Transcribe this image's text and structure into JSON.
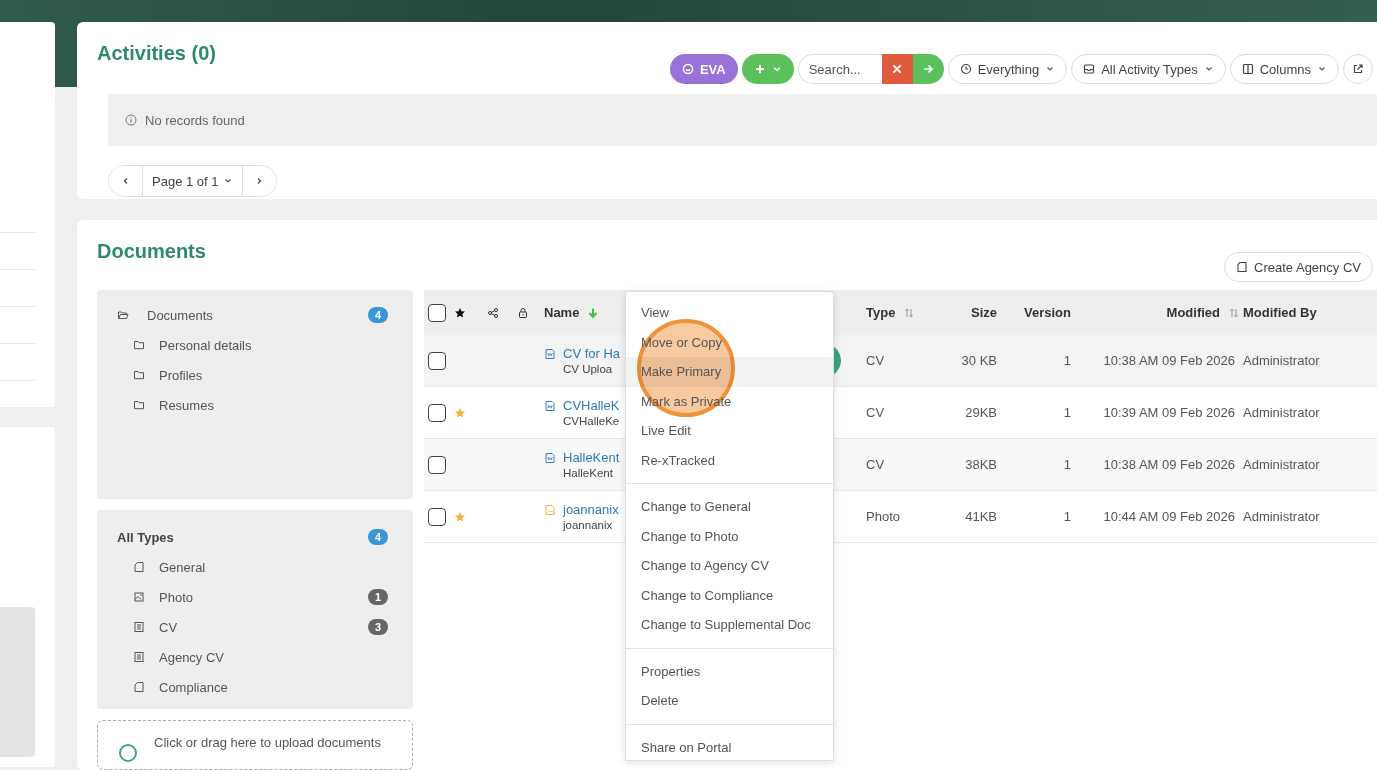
{
  "activities": {
    "title": "Activities (0)",
    "toolbar": {
      "eva_label": "EVA",
      "search": {
        "placeholder": "Search..."
      },
      "filters": [
        {
          "kind": "clock",
          "label": "Everything"
        },
        {
          "kind": "inbox",
          "label": "All Activity Types"
        },
        {
          "kind": "columns",
          "label": "Columns"
        }
      ]
    },
    "empty_message": "No records found",
    "pagination": {
      "page_label": "Page 1 of 1"
    }
  },
  "documents": {
    "title": "Documents",
    "create_button": "Create Agency CV",
    "folders": [
      {
        "label": "Documents",
        "count": "4",
        "children": [
          {
            "label": "Personal details"
          },
          {
            "label": "Profiles"
          },
          {
            "label": "Resumes"
          }
        ]
      }
    ],
    "types": {
      "label": "All Types",
      "count": "4",
      "items": [
        {
          "kind": "page",
          "label": "General"
        },
        {
          "kind": "image",
          "label": "Photo",
          "count": "1"
        },
        {
          "kind": "list",
          "label": "CV",
          "count": "3"
        },
        {
          "kind": "list",
          "label": "Agency CV"
        },
        {
          "kind": "page",
          "label": "Compliance"
        }
      ]
    },
    "upload_hint": "Click or drag here to upload documents",
    "table": {
      "columns": {
        "name": "Name",
        "type": "Type",
        "size": "Size",
        "version": "Version",
        "modified": "Modified",
        "modified_by": "Modified By"
      },
      "select_all_checked": false,
      "rows": [
        {
          "kind": "doc",
          "checked": false,
          "starred": false,
          "menu_open": true,
          "name": "CV for Ha",
          "subtitle": "CV Uploa",
          "type": "CV",
          "size": "30 KB",
          "version": "1",
          "modified": "10:38 AM 09 Feb 2026",
          "modified_by": "Administrator"
        },
        {
          "kind": "doc",
          "checked": false,
          "starred": true,
          "menu_open": false,
          "name": "CVHalleK",
          "subtitle": "CVHalleKe",
          "type": "CV",
          "size": "29KB",
          "version": "1",
          "modified": "10:39 AM 09 Feb 2026",
          "modified_by": "Administrator"
        },
        {
          "kind": "doc",
          "checked": false,
          "starred": false,
          "menu_open": false,
          "name": "HalleKent",
          "subtitle": "HalleKent",
          "type": "CV",
          "size": "38KB",
          "version": "1",
          "modified": "10:38 AM 09 Feb 2026",
          "modified_by": "Administrator"
        },
        {
          "kind": "image",
          "checked": false,
          "starred": true,
          "menu_open": false,
          "name": "joannanix",
          "subtitle": "joannanix",
          "type": "Photo",
          "size": "41KB",
          "version": "1",
          "modified": "10:44 AM 09 Feb 2026",
          "modified_by": "Administrator"
        }
      ]
    },
    "context_menu": {
      "groups": [
        [
          {
            "label": "View",
            "highlighted": false
          },
          {
            "label": "Move or Copy",
            "highlighted": false
          },
          {
            "label": "Make Primary",
            "highlighted": true
          },
          {
            "label": "Mark as Private",
            "highlighted": false
          },
          {
            "label": "Live Edit",
            "highlighted": false
          },
          {
            "label": "Re-xTracked",
            "highlighted": false
          }
        ],
        [
          {
            "label": "Change to General",
            "highlighted": false
          },
          {
            "label": "Change to Photo",
            "highlighted": false
          },
          {
            "label": "Change to Agency CV",
            "highlighted": false
          },
          {
            "label": "Change to Compliance",
            "highlighted": false
          },
          {
            "label": "Change to Supplemental Doc",
            "highlighted": false
          }
        ],
        [
          {
            "label": "Properties",
            "highlighted": false
          },
          {
            "label": "Delete",
            "highlighted": false
          }
        ],
        [
          {
            "label": "Share on Portal",
            "highlighted": false
          }
        ]
      ]
    }
  }
}
